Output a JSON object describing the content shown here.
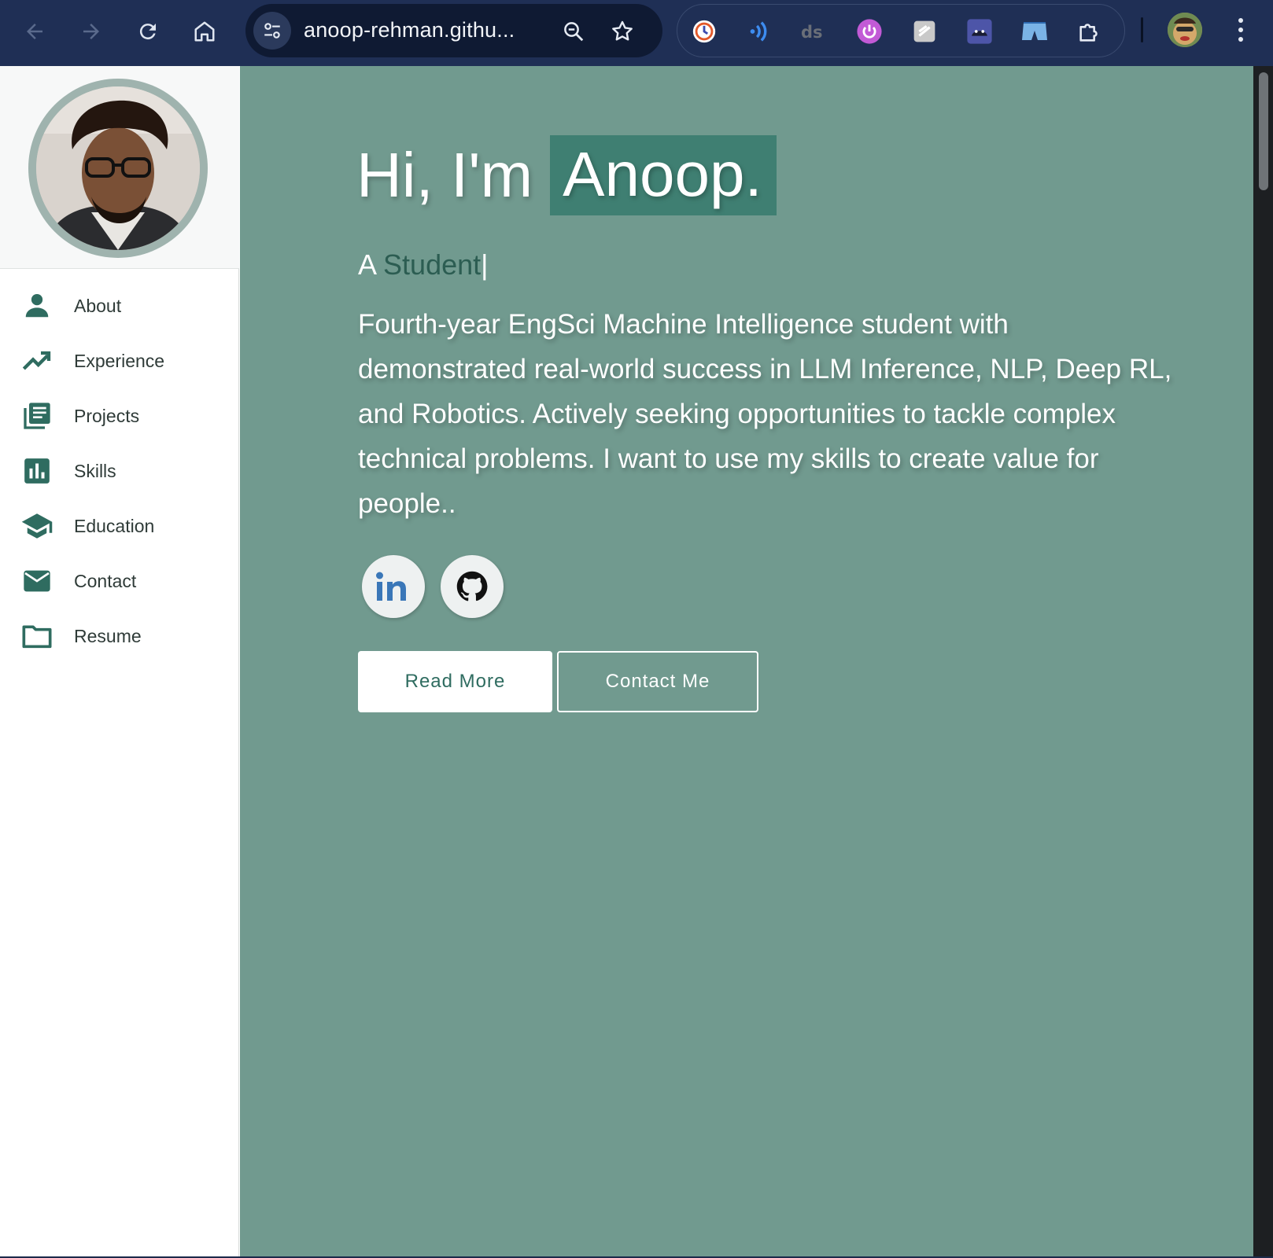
{
  "browser": {
    "url": "anoop-rehman.githu...",
    "icons": [
      "back-arrow-icon",
      "forward-arrow-icon",
      "reload-icon",
      "home-icon",
      "site-info-icon",
      "zoom-icon",
      "bookmark-star-icon",
      "extensions-puzzle-icon",
      "menu-dots-icon"
    ],
    "extensions": [
      "clock-extension-icon",
      "audio-waves-extension-icon",
      "ds-extension-icon",
      "power-extension-icon",
      "notes-extension-icon",
      "dark-mask-extension-icon",
      "shorts-extension-icon"
    ]
  },
  "sidebar": {
    "items": [
      {
        "label": "About",
        "icon": "person-icon"
      },
      {
        "label": "Experience",
        "icon": "trending-up-icon"
      },
      {
        "label": "Projects",
        "icon": "library-books-icon"
      },
      {
        "label": "Skills",
        "icon": "bar-chart-icon"
      },
      {
        "label": "Education",
        "icon": "graduation-cap-icon"
      },
      {
        "label": "Contact",
        "icon": "envelope-icon"
      },
      {
        "label": "Resume",
        "icon": "folder-icon"
      }
    ]
  },
  "hero": {
    "greeting": "Hi, I'm",
    "name": "Anoop.",
    "role_prefix": "A",
    "role_word": "Student",
    "cursor": "|",
    "bio": "Fourth-year EngSci Machine Intelligence student with demonstrated real-world success in LLM Inference, NLP, Deep RL, and Robotics. Actively seeking opportunities to tackle complex technical problems. I want to use my skills to create value for people..",
    "social": [
      "linkedin-icon",
      "github-icon"
    ],
    "read_more": "Read More",
    "contact_me": "Contact Me"
  },
  "colors": {
    "toolbar": "#1f2f55",
    "main_bg": "#719a8f",
    "accent": "#3f7f72",
    "sidebar_icon": "#2f6c60"
  }
}
